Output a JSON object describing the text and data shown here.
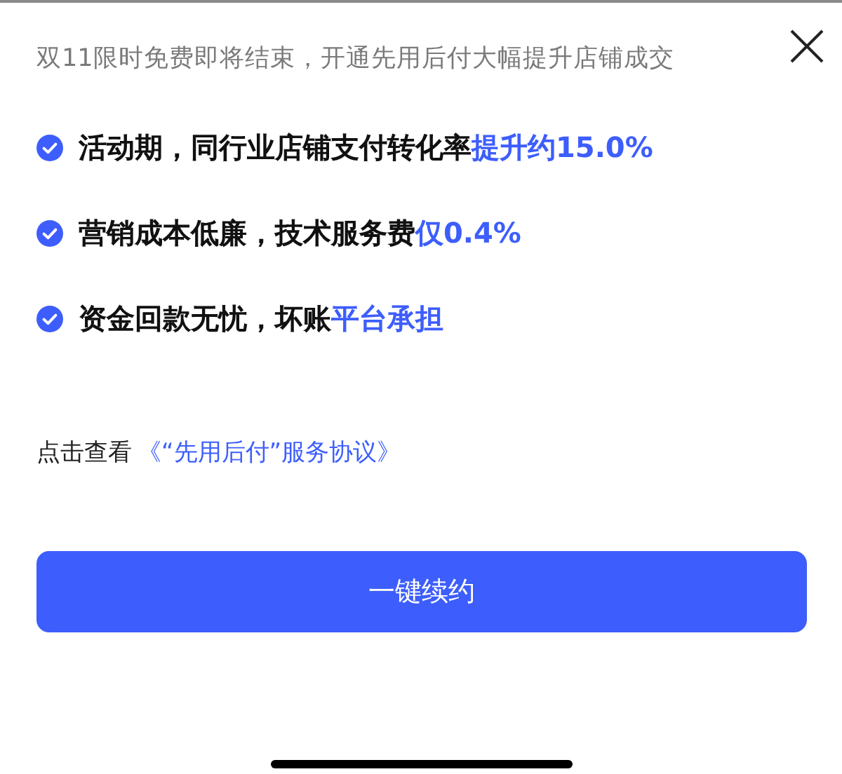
{
  "header": {
    "title": "双11限时免费即将结束，开通先用后付大幅提升店铺成交"
  },
  "benefits": [
    {
      "text": "活动期，同行业店铺支付转化率",
      "highlight": "提升约15.0%"
    },
    {
      "text": "营销成本低廉，技术服务费",
      "highlight": "仅0.4%"
    },
    {
      "text": "资金回款无忧，坏账",
      "highlight": "平台承担"
    }
  ],
  "agreement": {
    "prefix": "点击查看",
    "link": "《“先用后付”服务协议》"
  },
  "button": {
    "label": "一键续约"
  }
}
